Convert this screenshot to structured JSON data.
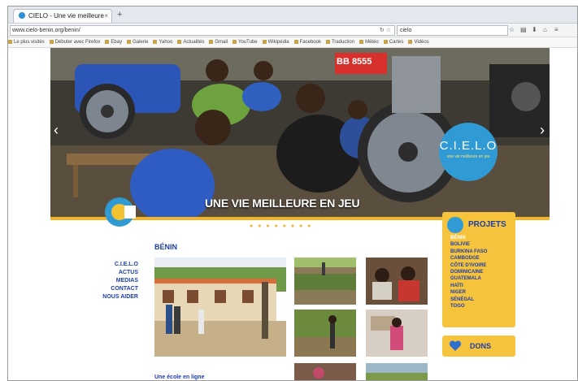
{
  "browser": {
    "tab_title": "CIELO - Une vie meilleure",
    "tab_close": "×",
    "new_tab": "+",
    "url": "www.cielo-benin.org/benin/",
    "search_value": "cielo",
    "bookmarks": [
      "Le plus visités",
      "Débuter avec Firefox",
      "Ebay",
      "Galerie",
      "Yahoo",
      "Actualités",
      "Gmail",
      "YouTube",
      "Wikipédia",
      "Facebook",
      "Traduction",
      "Météo",
      "Cartes",
      "Vidéos"
    ]
  },
  "hero": {
    "slogan": "UNE VIE MEILLEURE EN JEU",
    "badge_name": "C.I.E.L.O",
    "badge_sub": "une vie meilleure en jeu",
    "prev_arrow": "‹",
    "next_arrow": "›",
    "plate_text": "BB 8555",
    "dots": "● ● ● ● ● ● ● ●"
  },
  "leftnav": [
    "C.I.E.L.O",
    "ACTUS",
    "MEDIAS",
    "CONTACT",
    "NOUS AIDER"
  ],
  "content": {
    "section_title": "BÉNIN",
    "bottom_link": "Une école en ligne"
  },
  "sidebar": {
    "projets_title": "PROJETS",
    "projects": [
      "BÉNIN",
      "BOLIVIE",
      "BURKINA FASO",
      "CAMBODGE",
      "CÔTE D'IVOIRE",
      "DOMINICAINE",
      "GUATEMALA",
      "HAÏTI",
      "NIGER",
      "SÉNÉGAL",
      "TOGO"
    ],
    "active_project": 0,
    "dons_label": "DONS"
  },
  "colors": {
    "accent_yellow": "#f6c33c",
    "brand_blue": "#2f9ad3",
    "link_blue": "#1e3ea8"
  }
}
